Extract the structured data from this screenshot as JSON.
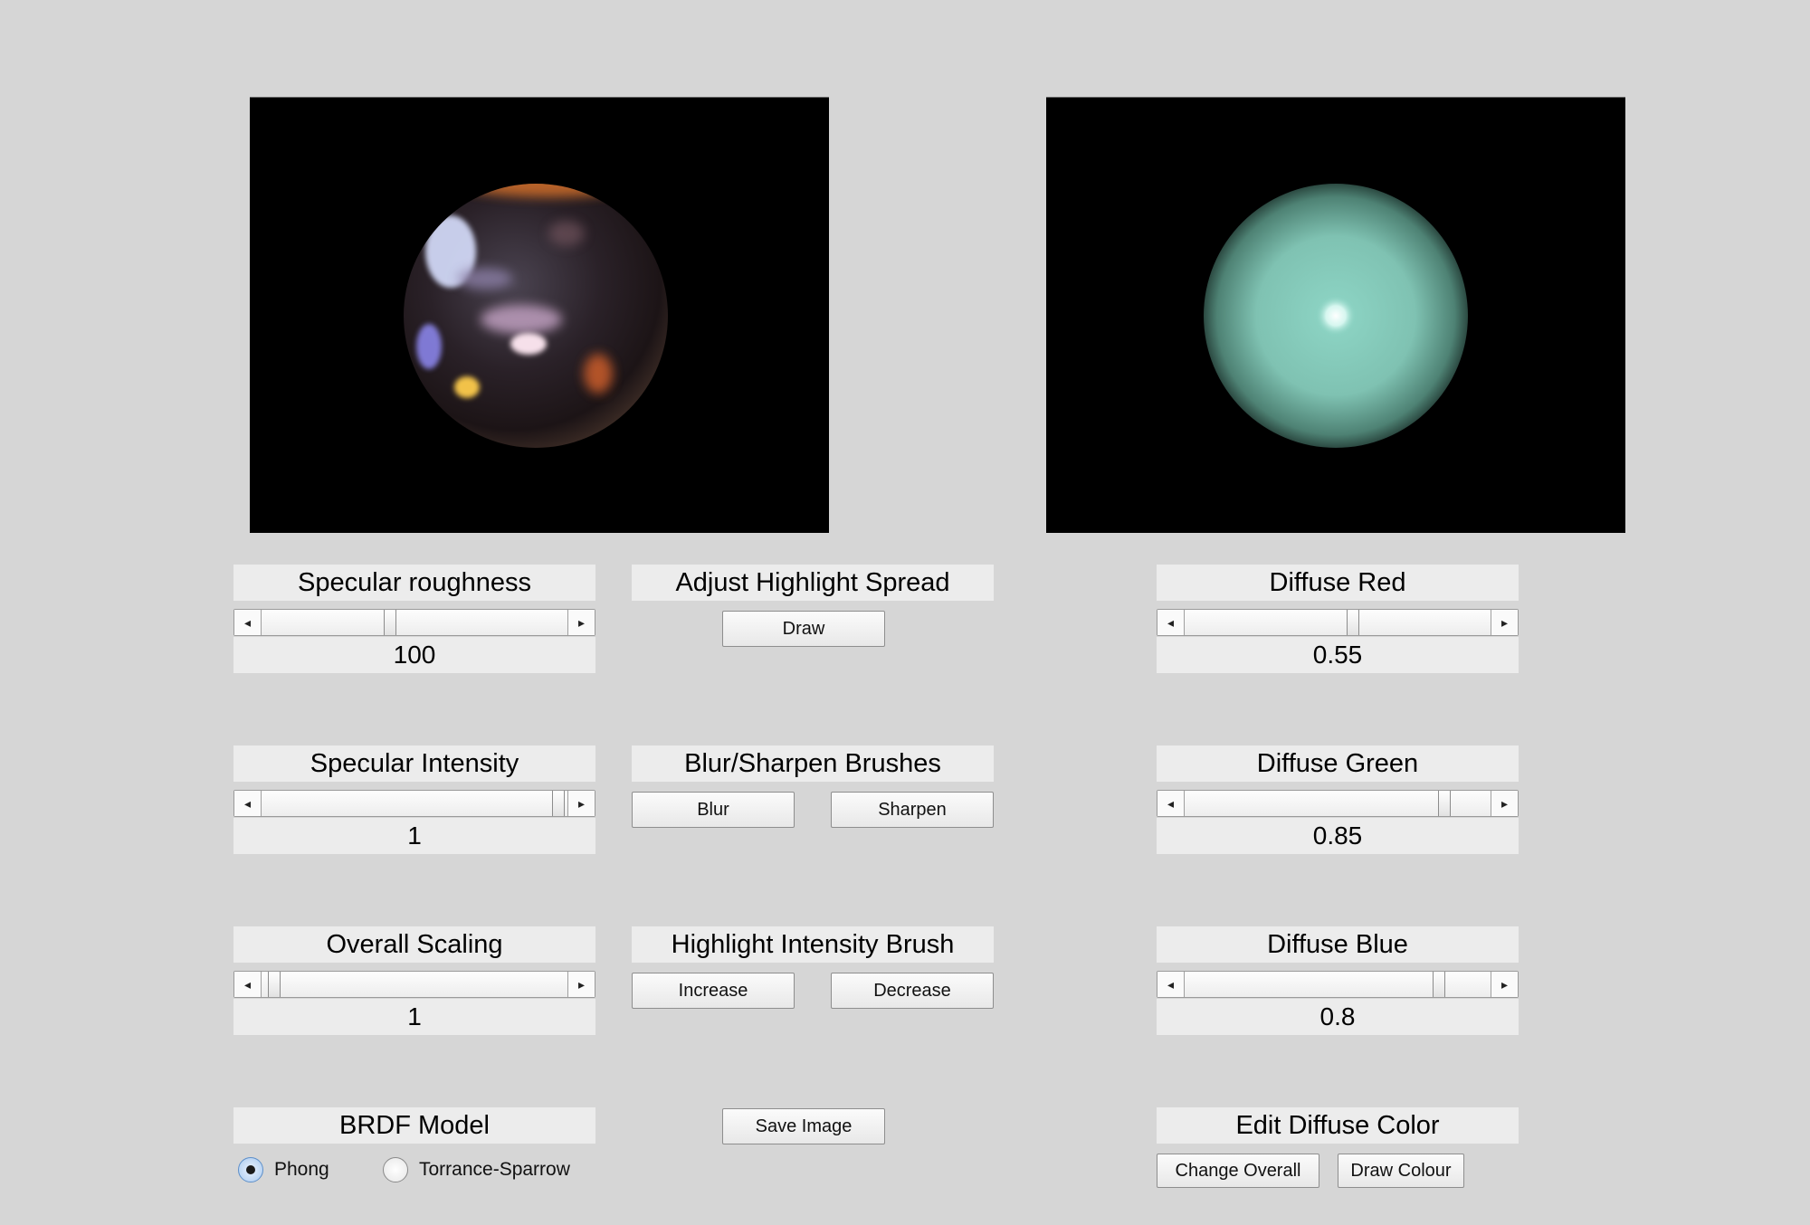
{
  "render_left": {
    "name": "specular-render"
  },
  "render_right": {
    "name": "diffuse-render"
  },
  "specular_roughness": {
    "label": "Specular roughness",
    "value": "100",
    "slider_fraction": 0.42
  },
  "specular_intensity": {
    "label": "Specular Intensity",
    "value": "1",
    "slider_fraction": 0.99
  },
  "overall_scaling": {
    "label": "Overall Scaling",
    "value": "1",
    "slider_fraction": 0.04
  },
  "brdf_model": {
    "label": "BRDF Model",
    "options": [
      {
        "label": "Phong",
        "selected": true
      },
      {
        "label": "Torrance-Sparrow",
        "selected": false
      }
    ]
  },
  "highlight_spread": {
    "label": "Adjust Highlight Spread",
    "draw_button": "Draw"
  },
  "blur_sharpen": {
    "label": "Blur/Sharpen Brushes",
    "blur_button": "Blur",
    "sharpen_button": "Sharpen"
  },
  "highlight_intensity": {
    "label": "Highlight Intensity Brush",
    "increase_button": "Increase",
    "decrease_button": "Decrease"
  },
  "save_button": "Save Image",
  "diffuse_red": {
    "label": "Diffuse Red",
    "value": "0.55",
    "slider_fraction": 0.55
  },
  "diffuse_green": {
    "label": "Diffuse Green",
    "value": "0.85",
    "slider_fraction": 0.85
  },
  "diffuse_blue": {
    "label": "Diffuse Blue",
    "value": "0.8",
    "slider_fraction": 0.83
  },
  "edit_diffuse": {
    "label": "Edit Diffuse Color",
    "change_overall_button": "Change Overall",
    "draw_colour_button": "Draw Colour"
  },
  "colors": {
    "background": "#d6d6d6",
    "panel": "#ececec",
    "canvas": "#000000",
    "diffuse_sphere": "#7fc2b2"
  }
}
